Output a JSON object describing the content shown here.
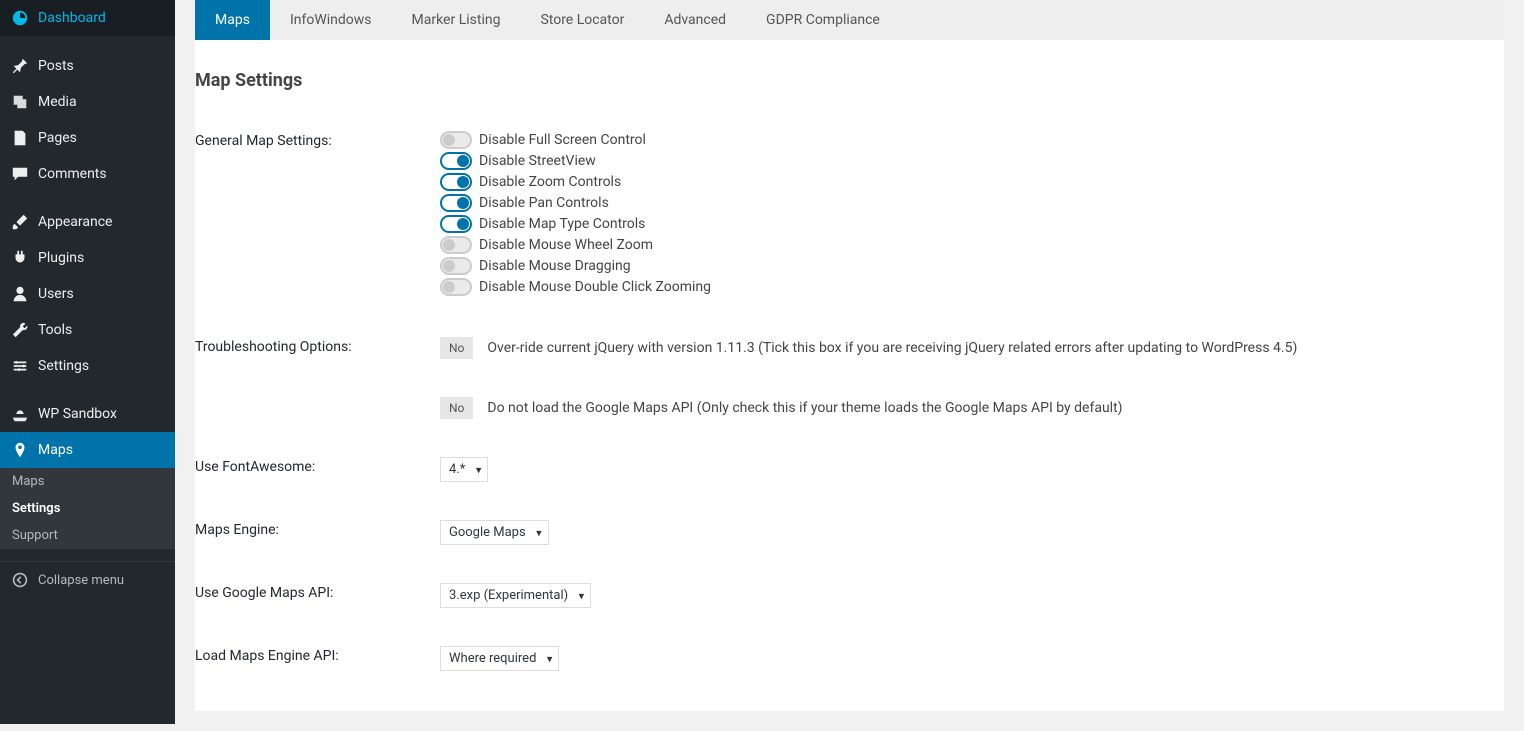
{
  "sidebar": {
    "items": [
      {
        "label": "Dashboard",
        "icon": "dashboard"
      },
      {
        "label": "Posts",
        "icon": "pin"
      },
      {
        "label": "Media",
        "icon": "media"
      },
      {
        "label": "Pages",
        "icon": "pages"
      },
      {
        "label": "Comments",
        "icon": "comments"
      },
      {
        "label": "Appearance",
        "icon": "brush"
      },
      {
        "label": "Plugins",
        "icon": "plug"
      },
      {
        "label": "Users",
        "icon": "user"
      },
      {
        "label": "Tools",
        "icon": "wrench"
      },
      {
        "label": "Settings",
        "icon": "settings"
      },
      {
        "label": "WP Sandbox",
        "icon": "sandbox"
      },
      {
        "label": "Maps",
        "icon": "maps"
      }
    ],
    "sub_items": [
      {
        "label": "Maps"
      },
      {
        "label": "Settings"
      },
      {
        "label": "Support"
      }
    ],
    "collapse": "Collapse menu"
  },
  "tabs": [
    {
      "label": "Maps"
    },
    {
      "label": "InfoWindows"
    },
    {
      "label": "Marker Listing"
    },
    {
      "label": "Store Locator"
    },
    {
      "label": "Advanced"
    },
    {
      "label": "GDPR Compliance"
    }
  ],
  "page": {
    "title": "Map Settings"
  },
  "settings": {
    "general_label": "General Map Settings:",
    "toggles": [
      {
        "label": "Disable Full Screen Control",
        "on": false
      },
      {
        "label": "Disable StreetView",
        "on": true
      },
      {
        "label": "Disable Zoom Controls",
        "on": true
      },
      {
        "label": " Disable Pan Controls",
        "on": true
      },
      {
        "label": "Disable Map Type Controls",
        "on": true
      },
      {
        "label": "Disable Mouse Wheel Zoom",
        "on": false
      },
      {
        "label": "Disable Mouse Dragging",
        "on": false
      },
      {
        "label": "Disable Mouse Double Click Zooming",
        "on": false
      }
    ],
    "troubleshoot_label": "Troubleshooting Options:",
    "no_label": "No",
    "troubleshoot1": "Over-ride current jQuery with version 1.11.3 (Tick this box if you are receiving jQuery related errors after updating to WordPress 4.5)",
    "troubleshoot2": "Do not load the Google Maps API (Only check this if your theme loads the Google Maps API by default)",
    "fontawesome_label": "Use FontAwesome:",
    "fontawesome_value": "4.*",
    "maps_engine_label": "Maps Engine:",
    "maps_engine_value": "Google Maps",
    "google_api_label": "Use Google Maps API:",
    "google_api_value": "3.exp (Experimental)",
    "load_engine_label": "Load Maps Engine API:",
    "load_engine_value": "Where required"
  }
}
